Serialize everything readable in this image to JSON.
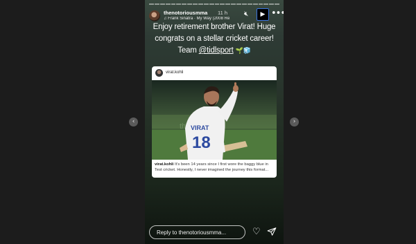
{
  "story": {
    "username": "thenotoriousmma",
    "time_ago": "11 h",
    "song": "Frank Sinatra · My Way (2008 Re",
    "caption": {
      "text": "Enjoy retirement brother Virat! Huge congrats on a stellar cricket career! Team",
      "mention": "@tidlsport",
      "emoji": "🌱🧊"
    },
    "icons": {
      "mute": "speaker-muted-icon",
      "play": "play-icon",
      "more": "more-icon",
      "heart": "heart-icon",
      "send": "send-icon"
    }
  },
  "shared_post": {
    "username": "virat.kohli",
    "jersey_name": "VIRAT",
    "jersey_number": "18",
    "caption_user": "virat.kohli",
    "caption_text": "It's been 14 years since I first wore the baggy blue in Test cricket. Honestly, I never imagined the journey this format..."
  },
  "reply": {
    "placeholder": "Reply to thenotoriousmma..."
  },
  "nav": {
    "prev": "‹",
    "next": "›"
  },
  "colors": {
    "play_border": "#3a74e0",
    "backdrop": "#1c1c1c"
  }
}
